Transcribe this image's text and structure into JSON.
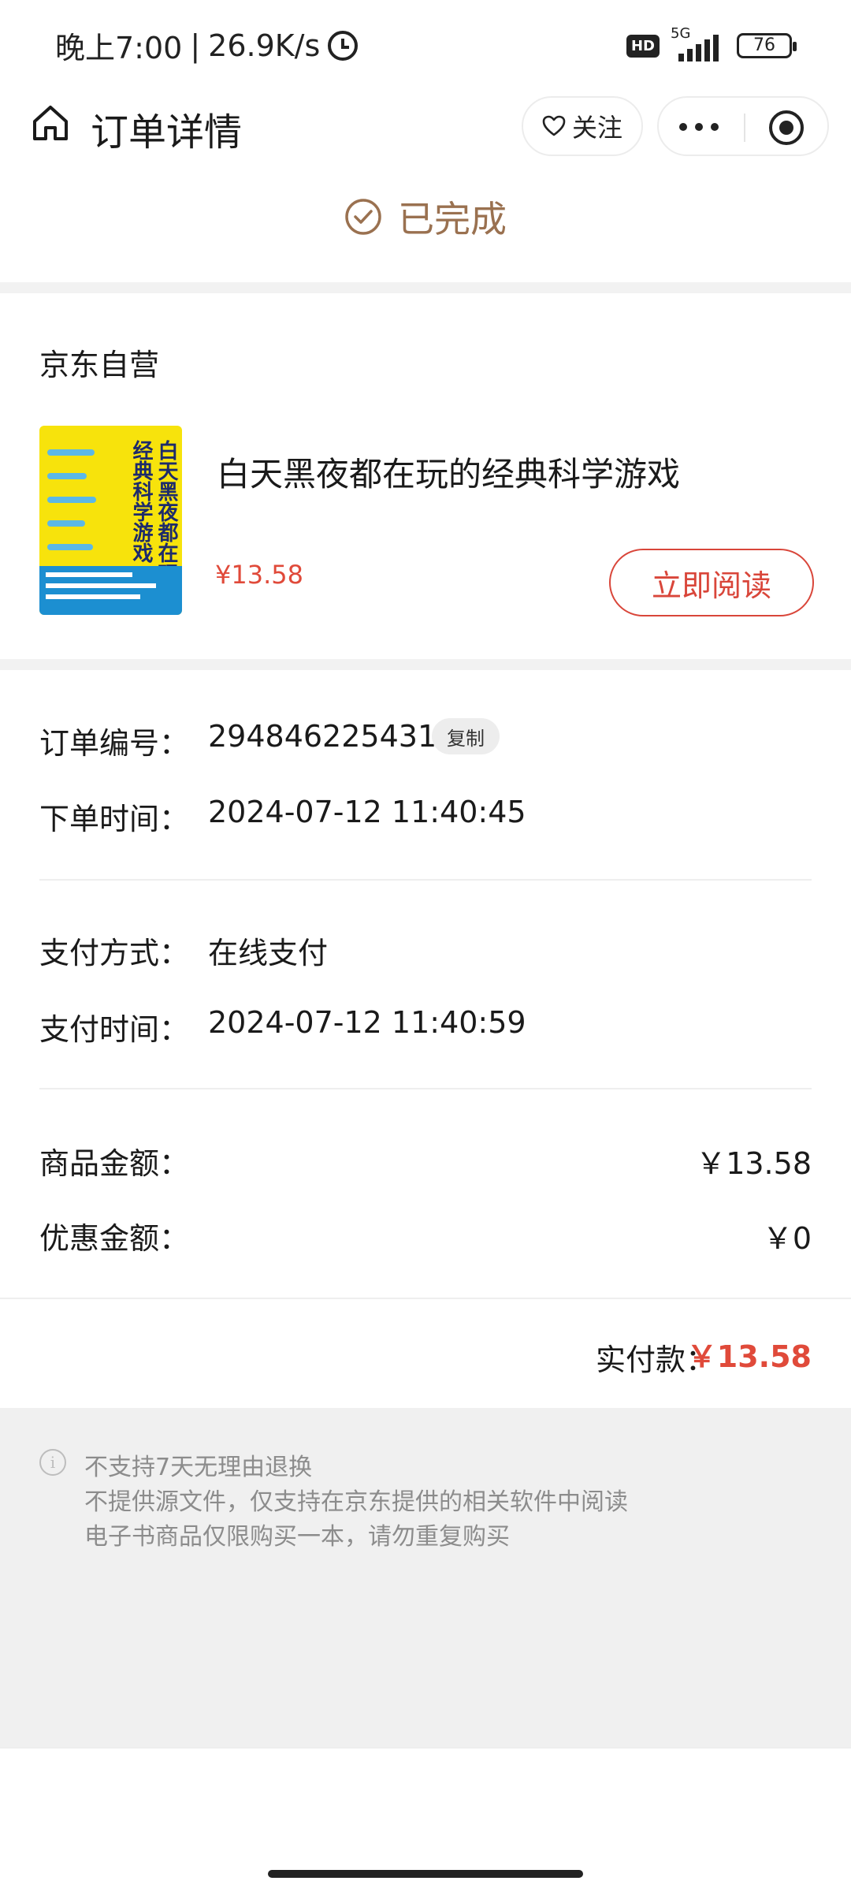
{
  "status_bar": {
    "time": "晚上7:00",
    "speed": "26.9K/s",
    "hd": "HD",
    "network": "5G",
    "battery": "76"
  },
  "nav": {
    "title": "订单详情",
    "follow_label": "关注"
  },
  "order_status": "已完成",
  "shop": {
    "name": "京东自营"
  },
  "product": {
    "title": "白天黑夜都在玩的经典科学游戏",
    "price": "¥13.58",
    "cover_title": "白天黑夜都在玩的经典科学游戏",
    "read_button": "立即阅读"
  },
  "order_info": {
    "order_no_label": "订单编号：",
    "order_no": "294846225431",
    "copy_label": "复制",
    "order_time_label": "下单时间：",
    "order_time": "2024-07-12 11:40:45",
    "pay_method_label": "支付方式：",
    "pay_method": "在线支付",
    "pay_time_label": "支付时间：",
    "pay_time": "2024-07-12 11:40:59"
  },
  "amounts": {
    "goods_label": "商品金额：",
    "goods_value": "￥13.58",
    "discount_label": "优惠金额：",
    "discount_value": "￥0",
    "paid_label": "实付款：",
    "paid_value": "￥13.58"
  },
  "notice": {
    "lines": [
      "不支持7天无理由退换",
      "不提供源文件，仅支持在京东提供的相关软件中阅读",
      "电子书商品仅限购买一本，请勿重复购买"
    ]
  },
  "colors": {
    "accent_red": "#d9463a",
    "status_brown": "#9a7150"
  }
}
